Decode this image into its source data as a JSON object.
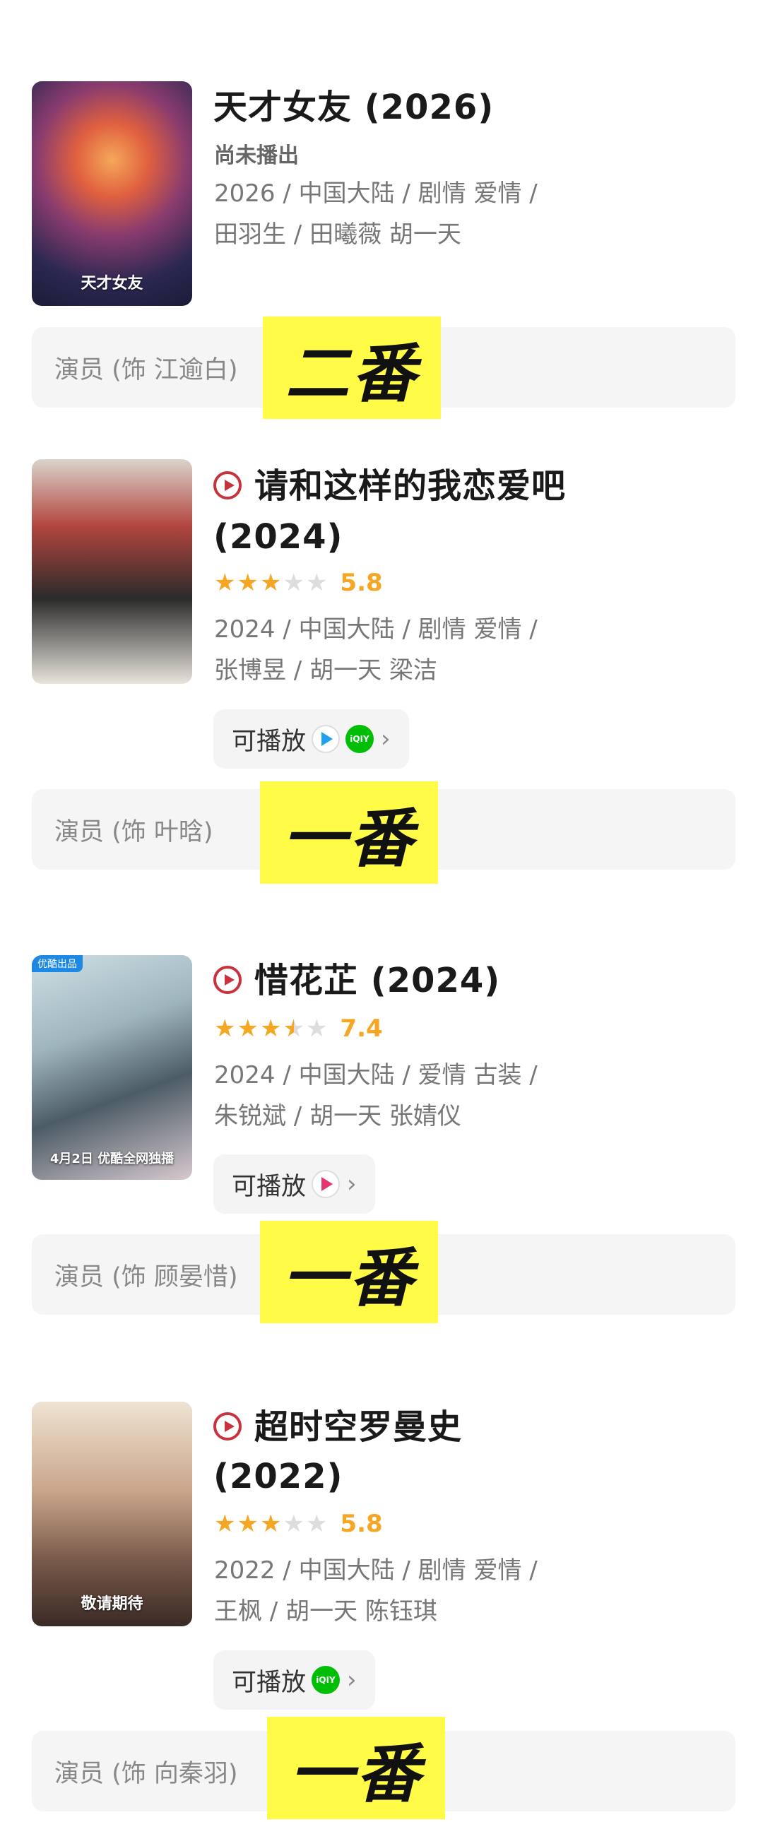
{
  "items": [
    {
      "title": "天才女友 (2026)",
      "status": "尚未播出",
      "meta_line1": "2026 / 中国大陆 / 剧情 爱情 /",
      "meta_line2": "田羽生 / 田曦薇 胡一天",
      "poster_text": "天才女友",
      "role": "演员 (饰 江逾白)",
      "tag": "二番"
    },
    {
      "title_line1": "请和这样的我恋爱吧",
      "title_line2": "(2024)",
      "rating": 3,
      "score": "5.8",
      "meta_line1": "2024 / 中国大陆 / 剧情 爱情 /",
      "meta_line2": "张博昱 / 胡一天 梁洁",
      "playable_label": "可播放",
      "platforms": [
        "tencent-video-icon",
        "iqiyi-icon"
      ],
      "role": "演员 (饰 叶晗)",
      "tag": "一番"
    },
    {
      "title": "惜花芷 (2024)",
      "rating": 3.5,
      "score": "7.4",
      "meta_line1": "2024 / 中国大陆 / 爱情 古装 /",
      "meta_line2": "朱锐斌 / 胡一天 张婧仪",
      "playable_label": "可播放",
      "platforms": [
        "youku-icon"
      ],
      "poster_badge": "优酷出品",
      "poster_text": "4月2日 优酷全网独播",
      "role": "演员 (饰 顾晏惜)",
      "tag": "一番"
    },
    {
      "title_line1": "超时空罗曼史",
      "title_line2": "(2022)",
      "rating": 3,
      "score": "5.8",
      "meta_line1": "2022 / 中国大陆 / 剧情 爱情 /",
      "meta_line2": "王枫 / 胡一天 陈钰琪",
      "playable_label": "可播放",
      "platforms": [
        "iqiyi-icon"
      ],
      "poster_text": "敬请期待",
      "role": "演员 (饰 向秦羽)",
      "tag": "一番"
    }
  ],
  "colors": {
    "accent_star": "#f5a623",
    "play_icon": "#c8323c",
    "tag_highlight": "#fffb46"
  }
}
